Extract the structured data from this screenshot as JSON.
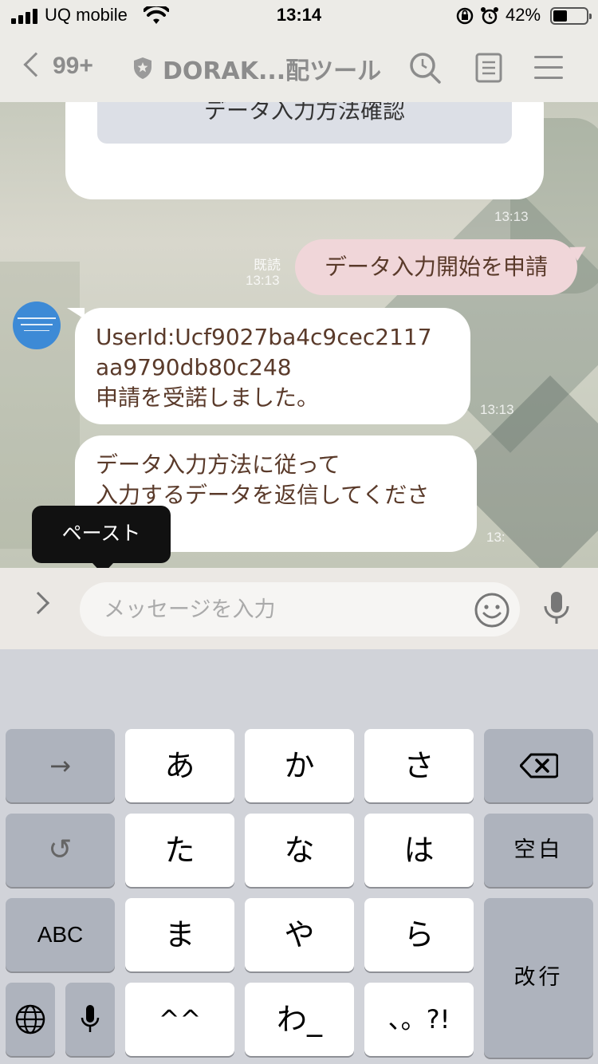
{
  "status_bar": {
    "carrier": "UQ mobile",
    "time": "13:14",
    "battery_percent": "42%",
    "battery_level": 0.42
  },
  "header": {
    "back_count": "99+",
    "title": "DORAK...配ツール"
  },
  "chat": {
    "card_button": "データ入力方法確認",
    "card_time": "13:13",
    "my_message": "データ入力開始を申請",
    "read_label": "既読",
    "my_time": "13:13",
    "reply1_line1": "UserId:Ucf9027ba4c9cec2117",
    "reply1_line2": "aa9790db80c248",
    "reply1_line3": "申請を受諾しました。",
    "reply1_time": "13:13",
    "reply2_line1": "データ入力方法に従って",
    "reply2_line2": "入力するデータを返信してくださ",
    "reply2_time": "13:"
  },
  "tooltip": {
    "paste": "ペースト"
  },
  "input": {
    "placeholder": "メッセージを入力"
  },
  "keyboard": {
    "arrow": "→",
    "undo": "↺",
    "abc": "ABC",
    "a": "あ",
    "ka": "か",
    "sa": "さ",
    "ta": "た",
    "na": "な",
    "ha": "は",
    "ma": "ま",
    "ya": "や",
    "ra": "ら",
    "kaomoji": "^^",
    "wa": "わ_",
    "punct": "、。?!",
    "space": "空白",
    "enter": "改行"
  },
  "icons": [
    "signal-icon",
    "wifi-icon",
    "rotation-lock-icon",
    "alarm-icon",
    "battery-icon",
    "back-chevron-icon",
    "shield-icon",
    "search-icon",
    "note-icon",
    "menu-icon",
    "expand-icon",
    "emoji-icon",
    "mic-icon",
    "globe-icon",
    "backspace-icon"
  ]
}
